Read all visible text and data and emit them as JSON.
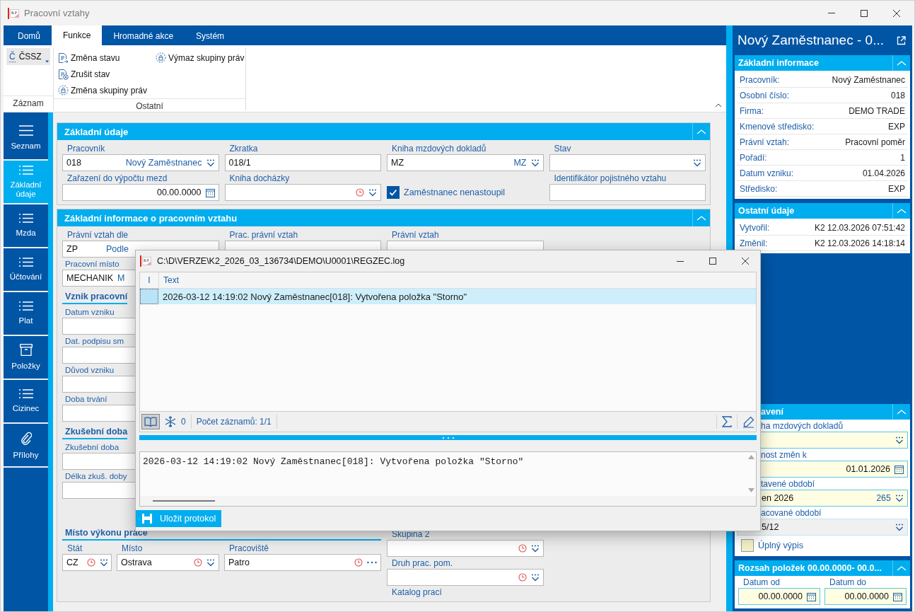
{
  "window": {
    "title": "Pracovní vztahy"
  },
  "ribbon": {
    "tabs": [
      {
        "label": "Domů",
        "selected": false
      },
      {
        "label": "Funkce",
        "selected": true
      },
      {
        "label": "Hromadné akce",
        "selected": false
      },
      {
        "label": "Systém",
        "selected": false
      }
    ],
    "groups": [
      {
        "title": "Záznam",
        "buttons": [
          {
            "kind": "split",
            "glyph": "Č",
            "label": "ČSSZ"
          }
        ]
      },
      {
        "title": "Ostatní",
        "buttons": [
          {
            "kind": "doc-arrow",
            "label": "Změna stavu"
          },
          {
            "kind": "doc-cancel",
            "label": "Zrušit stav"
          },
          {
            "kind": "lock",
            "label": "Změna skupiny práv"
          },
          {
            "kind": "lock",
            "label": "Výmaz skupiny práv"
          }
        ]
      }
    ]
  },
  "nav": [
    {
      "kind": "menu",
      "label": "Seznam",
      "selected": false
    },
    {
      "kind": "list",
      "label": "Základní údaje",
      "selected": true
    },
    {
      "kind": "list",
      "label": "Mzda",
      "selected": false
    },
    {
      "kind": "list",
      "label": "Účtování",
      "selected": false
    },
    {
      "kind": "list",
      "label": "Plat",
      "selected": false
    },
    {
      "kind": "box",
      "label": "Položky",
      "selected": false
    },
    {
      "kind": "list",
      "label": "Cizinec",
      "selected": false
    },
    {
      "kind": "clip",
      "label": "Přílohy",
      "selected": false
    }
  ],
  "basic": {
    "title": "Základní údaje",
    "expanded": true,
    "fields": [
      {
        "label": "Pracovník",
        "value": "018",
        "display": "Nový Zaměstnanec",
        "kind": "select"
      },
      {
        "label": "Zkratka",
        "value": "018/1",
        "kind": "text"
      },
      {
        "label": "Kniha mzdových dokladů",
        "value": "MZ",
        "display": "MZ",
        "kind": "select"
      },
      {
        "label": "Stav",
        "kind": "select"
      },
      {
        "label": "Zařazení do výpočtu mezd",
        "value": "00.00.0000",
        "kind": "date"
      },
      {
        "label": "Kniha docházky",
        "kind": "history-select"
      },
      {
        "label": "Zaměstnanec nenastoupil",
        "kind": "checkbox",
        "checked": true
      },
      {
        "label": "Identifikátor pojistného vztahu",
        "kind": "text"
      }
    ]
  },
  "relation": {
    "title": "Základní informace o pracovním vztahu",
    "expanded": true,
    "top_fields": [
      {
        "label": "Právní vztah dle",
        "value": "ZP",
        "display": "Podle",
        "kind": "lookup"
      },
      {
        "label": "Prac. právní vztah",
        "kind": "text"
      },
      {
        "label": "Právní vztah",
        "kind": "text"
      }
    ],
    "left_items": [
      {
        "label": "Pracovní místo",
        "value": "MECHANIK",
        "display": "M",
        "kind": "lookup"
      },
      {
        "label": "Vznik pracovní",
        "kind": "heading"
      },
      {
        "label": "Datum vzniku",
        "kind": "text"
      },
      {
        "label": "Dat. podpisu sm",
        "kind": "text"
      },
      {
        "label": "Důvod vzniku",
        "kind": "text"
      },
      {
        "label": "Doba trvání",
        "kind": "text"
      },
      {
        "label": "Zkušební doba",
        "kind": "heading"
      },
      {
        "label": "Zkušební doba",
        "kind": "text"
      },
      {
        "label": "Délka zkuš. doby",
        "kind": "text"
      }
    ],
    "workplace": {
      "heading": "Místo výkonu práce",
      "fields": [
        {
          "label": "Stát",
          "value": "CZ",
          "kind": "history-select"
        },
        {
          "label": "Místo",
          "value": "Ostrava",
          "kind": "history-select"
        },
        {
          "label": "Pracoviště",
          "value": "Patro",
          "kind": "history-more"
        }
      ]
    },
    "right_items": [
      {
        "label": "Skupina 2",
        "kind": "history-select"
      },
      {
        "label": "Druh prac. pom.",
        "kind": "history-select"
      },
      {
        "label": "Katalog prací",
        "kind": "caption"
      }
    ]
  },
  "dialog": {
    "title": "C:\\D\\VERZE\\K2_2026_03_136734\\DEMO\\U0001\\REGZEC.log",
    "columns": [
      "I",
      "Text"
    ],
    "rows": [
      {
        "text": "2026-03-12 14:19:02 Nový Zaměstnanec[018]: Vytvořena položka \"Storno\"",
        "selected": true
      }
    ],
    "preview_on": true,
    "filter_count": "0",
    "record_count": "Počet záznamů: 1/1",
    "detail": "2026-03-12 14:19:02 Nový Zaměstnanec[018]: Vytvořena položka \"Storno\"",
    "save_button": "Uložit protokol"
  },
  "side": {
    "title": "Nový Zaměstnanec - 0...",
    "basic": {
      "title": "Základní informace",
      "expanded": true,
      "rows": [
        {
          "label": "Pracovník:",
          "value": "Nový Zaměstnanec"
        },
        {
          "label": "Osobní číslo:",
          "value": "018"
        },
        {
          "label": "Firma:",
          "value": "DEMO TRADE"
        },
        {
          "label": "Kmenové středisko:",
          "value": "EXP"
        },
        {
          "label": "Právní vztah:",
          "value": "Pracovní poměr"
        },
        {
          "label": "Pořadí:",
          "value": "1"
        },
        {
          "label": "Datum vzniku:",
          "value": "01.04.2026"
        },
        {
          "label": "Středisko:",
          "value": "EXP"
        }
      ]
    },
    "other": {
      "title": "Ostatní údaje",
      "expanded": true,
      "rows": [
        {
          "label": "Vytvořil:",
          "value": "K2 12.03.2026 07:51:42"
        },
        {
          "label": "Změnil:",
          "value": "K2 12.03.2026 14:18:14"
        }
      ]
    },
    "settings": {
      "title": "avení",
      "expanded": true,
      "fields": [
        {
          "label": "ha mzdových dokladů",
          "kind": "select",
          "readonly": false
        },
        {
          "label": "nost změn k",
          "value": "01.01.2026",
          "kind": "date",
          "readonly": false
        },
        {
          "label": "tavené období",
          "value": "en 2026",
          "display": "265",
          "kind": "select",
          "readonly": false
        },
        {
          "label": "acované období",
          "value": "5/12",
          "kind": "select",
          "readonly": true
        },
        {
          "label": "Úplný výpis",
          "kind": "checkbox",
          "checked": false
        }
      ]
    },
    "range": {
      "title": "Rozsah položek 00.00.0000- 00.0...",
      "expanded": true,
      "fields": [
        {
          "label": "Datum od",
          "value": "00.00.0000",
          "kind": "date"
        },
        {
          "label": "Datum do",
          "value": "00.00.0000",
          "kind": "date"
        }
      ]
    }
  }
}
